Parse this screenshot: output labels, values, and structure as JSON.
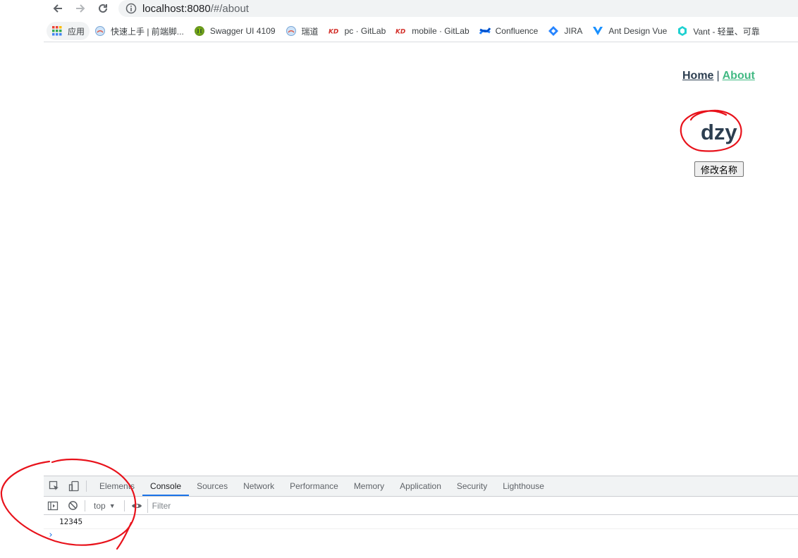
{
  "browser": {
    "url_host": "localhost:8080",
    "url_path": "/#/about",
    "bookmarks": [
      {
        "label": "应用",
        "icon": "apps-grid-icon"
      },
      {
        "label": "快速上手 | 前端脚...",
        "icon": "site-icon"
      },
      {
        "label": "Swagger UI 4109",
        "icon": "swagger-icon"
      },
      {
        "label": "瑞道",
        "icon": "site-icon"
      },
      {
        "label": "pc · GitLab",
        "icon": "gitlab-icon"
      },
      {
        "label": "mobile · GitLab",
        "icon": "gitlab-icon"
      },
      {
        "label": "Confluence",
        "icon": "confluence-icon"
      },
      {
        "label": "JIRA",
        "icon": "jira-icon"
      },
      {
        "label": "Ant Design Vue",
        "icon": "vue-icon"
      },
      {
        "label": "Vant - 轻量、可靠",
        "icon": "vant-icon"
      }
    ]
  },
  "page": {
    "nav": {
      "home": "Home",
      "separator": "|",
      "about": "About"
    },
    "name": "dzy",
    "rename_button": "修改名称"
  },
  "devtools": {
    "tabs": [
      "Elements",
      "Console",
      "Sources",
      "Network",
      "Performance",
      "Memory",
      "Application",
      "Security",
      "Lighthouse"
    ],
    "active_tab": "Console",
    "context": "top",
    "filter_placeholder": "Filter",
    "log": "12345",
    "prompt": "›"
  },
  "colors": {
    "vue_text": "#2c3e50",
    "vue_active": "#42b983",
    "annotation": "#e8121b",
    "devtools_accent": "#1a73e8"
  }
}
